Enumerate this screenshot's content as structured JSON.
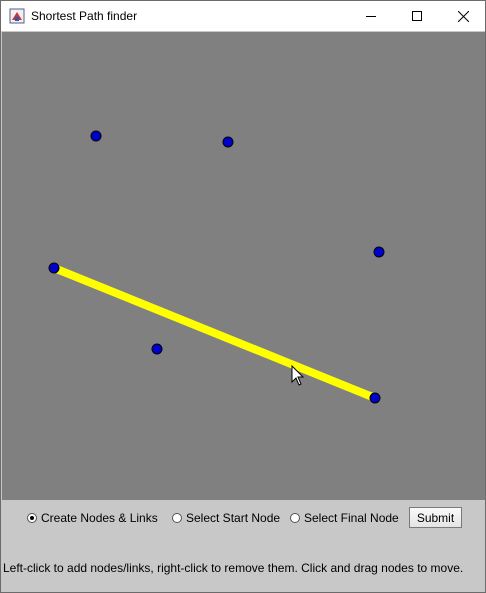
{
  "window": {
    "title": "Shortest Path finder",
    "icon": "java-app-icon",
    "controls": [
      "minimize-icon",
      "maximize-icon",
      "close-icon"
    ]
  },
  "canvas": {
    "background": "#808080",
    "node_color": "#0000cc",
    "link_color": "#ffff00",
    "node_count": 6,
    "link_count": 1
  },
  "controls": {
    "mode_options": [
      {
        "label": "Create Nodes & Links",
        "selected": true
      },
      {
        "label": "Select Start Node",
        "selected": false
      },
      {
        "label": "Select Final Node",
        "selected": false
      }
    ],
    "submit_label": "Submit"
  },
  "status": {
    "text": "Left-click to add nodes/links, right-click to remove them.  Click and drag nodes to move."
  }
}
